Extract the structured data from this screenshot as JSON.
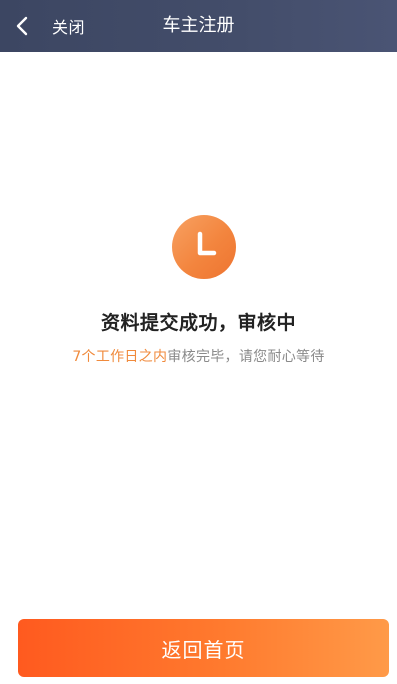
{
  "navbar": {
    "close_label": "关闭",
    "title": "车主注册",
    "background": "#434d6a"
  },
  "status": {
    "icon": "clock-icon",
    "title": "资料提交成功，审核中",
    "note_highlight": "7个工作日之内",
    "note_rest": "审核完毕，请您耐心等待",
    "accent": "#f08a3c"
  },
  "footer": {
    "home_button_label": "返回首页",
    "button_color": "#ff6a24"
  }
}
